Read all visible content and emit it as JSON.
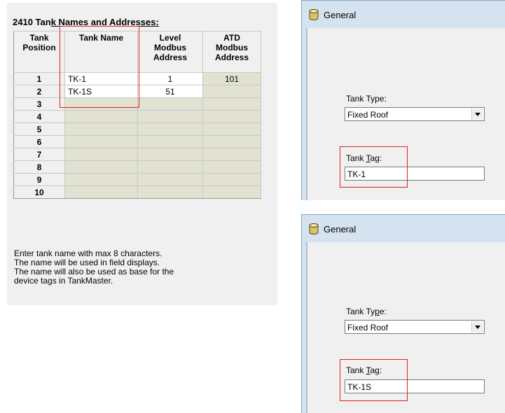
{
  "left_panel": {
    "title_prefix": "2410 Tan",
    "title_underlined": "k Names and Addresses:",
    "headers": {
      "position": [
        "Tank",
        "Position"
      ],
      "name": [
        "Tank Name"
      ],
      "level": [
        "Level",
        "Modbus",
        "Address"
      ],
      "atd": [
        "ATD",
        "Modbus",
        "Address"
      ]
    },
    "rows": [
      {
        "pos": "1",
        "name": "TK-1",
        "level": "1",
        "atd": "101"
      },
      {
        "pos": "2",
        "name": "TK-1S",
        "level": "51",
        "atd": ""
      },
      {
        "pos": "3",
        "name": "",
        "level": "",
        "atd": ""
      },
      {
        "pos": "4",
        "name": "",
        "level": "",
        "atd": ""
      },
      {
        "pos": "5",
        "name": "",
        "level": "",
        "atd": ""
      },
      {
        "pos": "6",
        "name": "",
        "level": "",
        "atd": ""
      },
      {
        "pos": "7",
        "name": "",
        "level": "",
        "atd": ""
      },
      {
        "pos": "8",
        "name": "",
        "level": "",
        "atd": ""
      },
      {
        "pos": "9",
        "name": "",
        "level": "",
        "atd": ""
      },
      {
        "pos": "10",
        "name": "",
        "level": "",
        "atd": ""
      }
    ],
    "help_lines": [
      "Enter tank name with max 8 characters.",
      "The name will be used in field displays.",
      "The name will also be used as base for the",
      "device tags in TankMaster."
    ]
  },
  "windows": [
    {
      "title": "General",
      "tank_type_label_pre": "Tank Type:",
      "tank_type_value": "Fixed Roof",
      "tank_tag_label_pre": "Tank ",
      "tank_tag_label_u": "T",
      "tank_tag_label_post": "ag:",
      "tank_tag_value": "TK-1"
    },
    {
      "title": "General",
      "tank_type_label_pre": "Tank Ty",
      "tank_type_label_u": "p",
      "tank_type_label_post": "e:",
      "tank_type_value": "Fixed Roof",
      "tank_tag_label_pre": "Tank ",
      "tank_tag_label_u": "T",
      "tank_tag_label_post": "ag:",
      "tank_tag_value": "TK-1S"
    }
  ],
  "colors": {
    "highlight": "#e02020",
    "disabled_cell": "#e2e2d2",
    "titlebar": "#d5e2ef"
  }
}
